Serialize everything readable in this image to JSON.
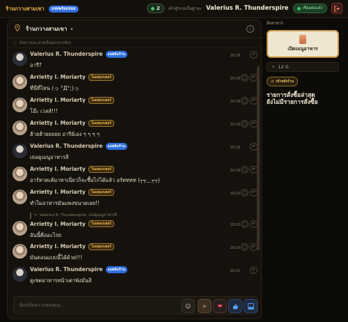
{
  "topbar": {
    "brand": "ร้านกวางสามเขา",
    "brand_badge": "แชทพร้อมชมย",
    "online_count": "2",
    "login_as": "เข้าสู่ระบบในฐานะ",
    "username": "Valerius R. Thunderspire",
    "connected": "เชื่อมต่อแล้ว"
  },
  "chat": {
    "room_title": "ร้านกวางสามเขา",
    "notice": "ข้อความจะหายเมื่อออกจากห้อง",
    "composer_placeholder": "พิมพ์ข้อความของคุณ...",
    "messages": [
      {
        "author": "Valerius R. Thunderspire",
        "tag": "แอดมินร้าน",
        "tag_type": "admin",
        "avatar": "val",
        "text": "อารี?",
        "time": "20:18",
        "reply_to": ""
      },
      {
        "author": "Arrietty I. Moriarty",
        "tag": "โมเดอเรเตอร์",
        "tag_type": "mod",
        "avatar": "arr",
        "text": "ที่นี่ที่ไหน (っ °Д°;)っ",
        "time": "20:18",
        "reply_to": ""
      },
      {
        "author": "Arrietty I. Moriarty",
        "tag": "โมเดอเรเตอร์",
        "tag_type": "mod",
        "avatar": "arr",
        "text": "โอ๊ะ เวลส์!!!",
        "time": "20:18",
        "reply_to": ""
      },
      {
        "author": "Arrietty I. Moriarty",
        "tag": "โมเดอเรเตอร์",
        "tag_type": "mod",
        "avatar": "arr",
        "text": "ฮ้าฮฮ้ายยยยย อารีย์เอง ๆ ๆ ๆ ๆ",
        "time": "20:18",
        "reply_to": ""
      },
      {
        "author": "Valerius R. Thunderspire",
        "tag": "แอดมินร้าน",
        "tag_type": "admin",
        "avatar": "val",
        "text": "เธอดูเมนูอาหารสิ",
        "time": "20:18",
        "reply_to": ""
      },
      {
        "author": "Arrietty I. Moriarty",
        "tag": "โมเดอเรเตอร์",
        "tag_type": "mod",
        "avatar": "arr",
        "text": "อาร์ทาดเค้มาทาเนี่ยวก็จะซื้อไก่ได้แล้ว อร์ทททท (┬┬﹏┬┬)",
        "time": "20:19",
        "reply_to": ""
      },
      {
        "author": "Arrietty I. Moriarty",
        "tag": "โมเดอเรเตอร์",
        "tag_type": "mod",
        "avatar": "arr",
        "text": "ทำไมอาหารมันแพงขนาดเลย!!",
        "time": "20:20",
        "reply_to": ""
      },
      {
        "author": "Arrietty I. Moriarty",
        "tag": "โมเดอเรเตอร์",
        "tag_type": "mod",
        "avatar": "arr",
        "text": "อันนี้คืออะไรย",
        "time": "20:20",
        "reply_to": "Valerius R. Thunderspire: เธอดูเมนูอาหารสิ"
      },
      {
        "author": "Arrietty I. Moriarty",
        "tag": "โมเดอเรเตอร์",
        "tag_type": "mod",
        "avatar": "arr",
        "text": "มันดอนแบบนี้ได้ด้วย!!!",
        "time": "20:20",
        "reply_to": ""
      },
      {
        "author": "Valerius R. Thunderspire",
        "tag": "แอดมินร้าน",
        "tag_type": "admin",
        "avatar": "val",
        "text": "ดูเซตอาหารหน้าเตาพังมั่นสิ",
        "time": "20:21",
        "reply_to": ""
      }
    ]
  },
  "order": {
    "label": "สั่งอาหาร",
    "open_menu": "เปิดเมนูอาหาร",
    "balance": "12 G",
    "orders_button": "เข้าหลังร้าน",
    "recent_title": "รายการสั่งซื้อล่าสุด",
    "recent_empty": "ยังไม่มีรายการสั่งซื้อ"
  },
  "colors": {
    "accent": "#c89640",
    "admin_tag": "#2f6fe0",
    "online": "#3ec86a",
    "background": "#0d0b08"
  },
  "icons": {
    "room": "map-pin-icon",
    "info": "info-icon",
    "react": "emoji-react-icon",
    "reply": "reply-icon",
    "send": "send-icon",
    "heart": "heart-icon",
    "thumb": "thumbs-up-icon",
    "image": "image-icon",
    "logout": "logout-icon"
  }
}
